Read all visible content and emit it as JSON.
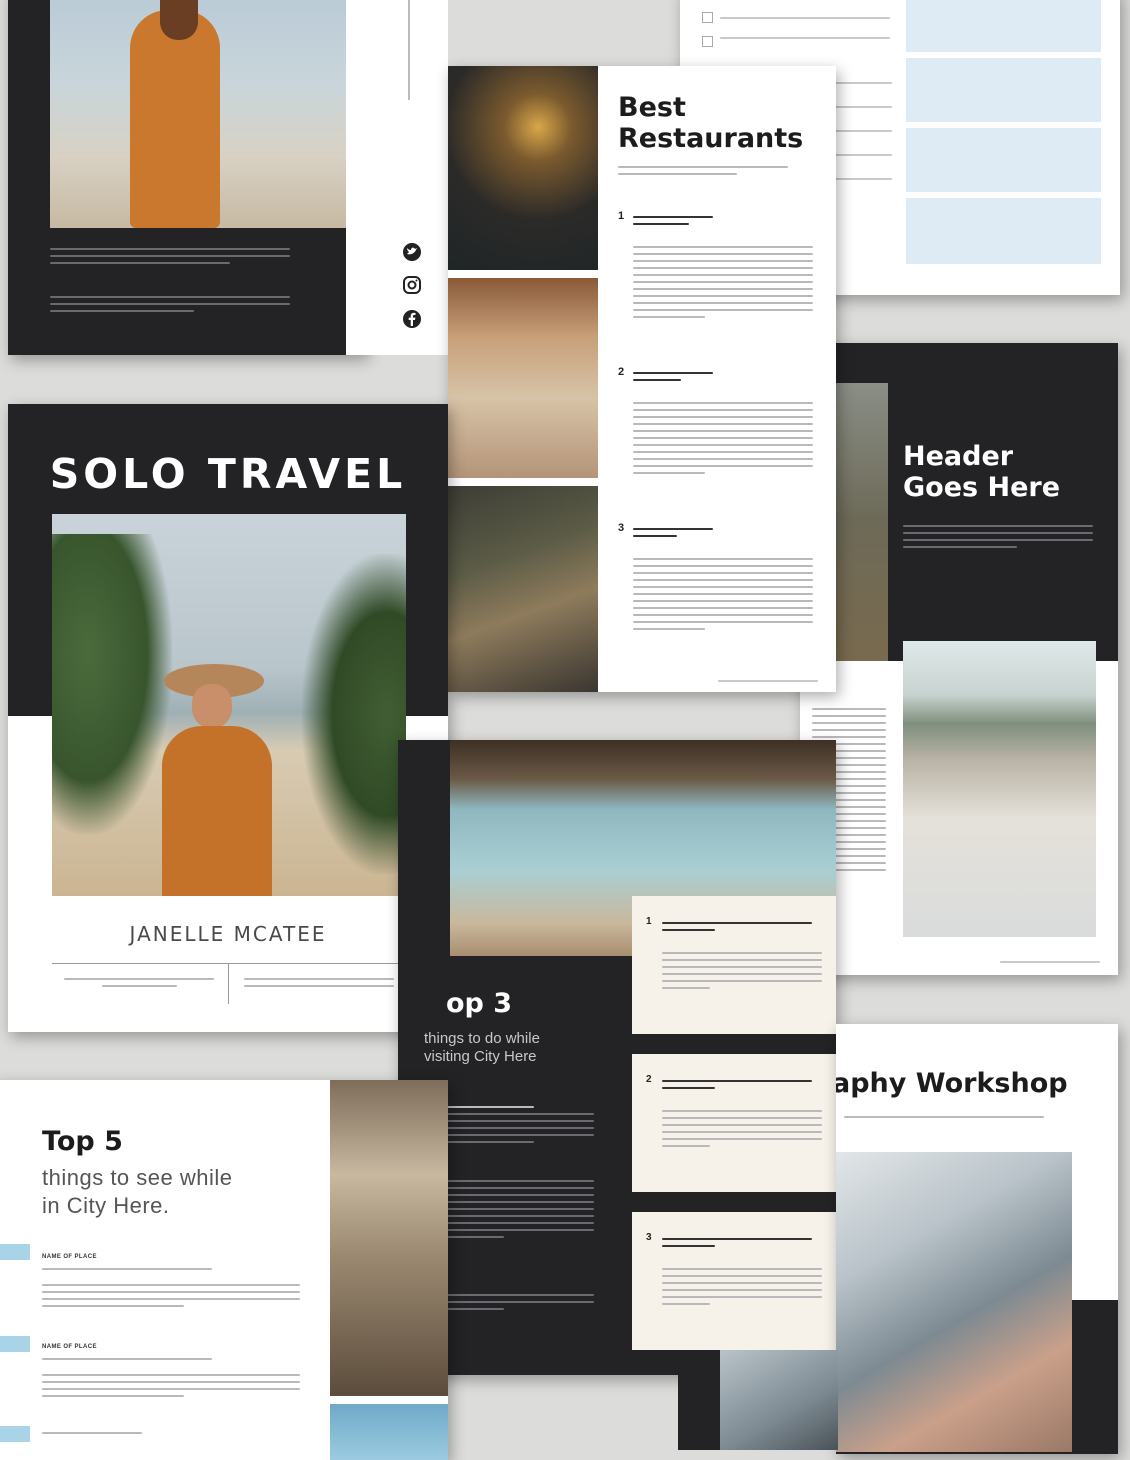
{
  "cover": {
    "title": "SOLO TRAVEL",
    "author": "JANELLE MCATEE"
  },
  "restaurants_page": {
    "title_line1": "Best",
    "title_line2": "Restaurants",
    "items": [
      {
        "number": "1"
      },
      {
        "number": "2"
      },
      {
        "number": "3"
      }
    ]
  },
  "header_page": {
    "title_line1": "Header",
    "title_line2": "Goes Here"
  },
  "top3_page": {
    "title": "op 3",
    "subtitle_line1": "things to do while",
    "subtitle_line2": "visiting City Here",
    "items": [
      {
        "number": "1"
      },
      {
        "number": "2"
      },
      {
        "number": "3"
      }
    ]
  },
  "workshop_page": {
    "title": "aphy Workshop"
  },
  "top5_page": {
    "title": "Top 5",
    "subtitle_line1": "things to see while",
    "subtitle_line2": "in City Here.",
    "places": [
      {
        "name": "NAME OF PLACE"
      },
      {
        "name": "NAME OF PLACE"
      }
    ]
  },
  "colors": {
    "dark_page": "#232326",
    "accent_blue": "#a9d3e6",
    "cream_card": "#f6f2ea",
    "form_field": "#deeaf4"
  },
  "icons": [
    "twitter-icon",
    "instagram-icon",
    "facebook-icon"
  ]
}
